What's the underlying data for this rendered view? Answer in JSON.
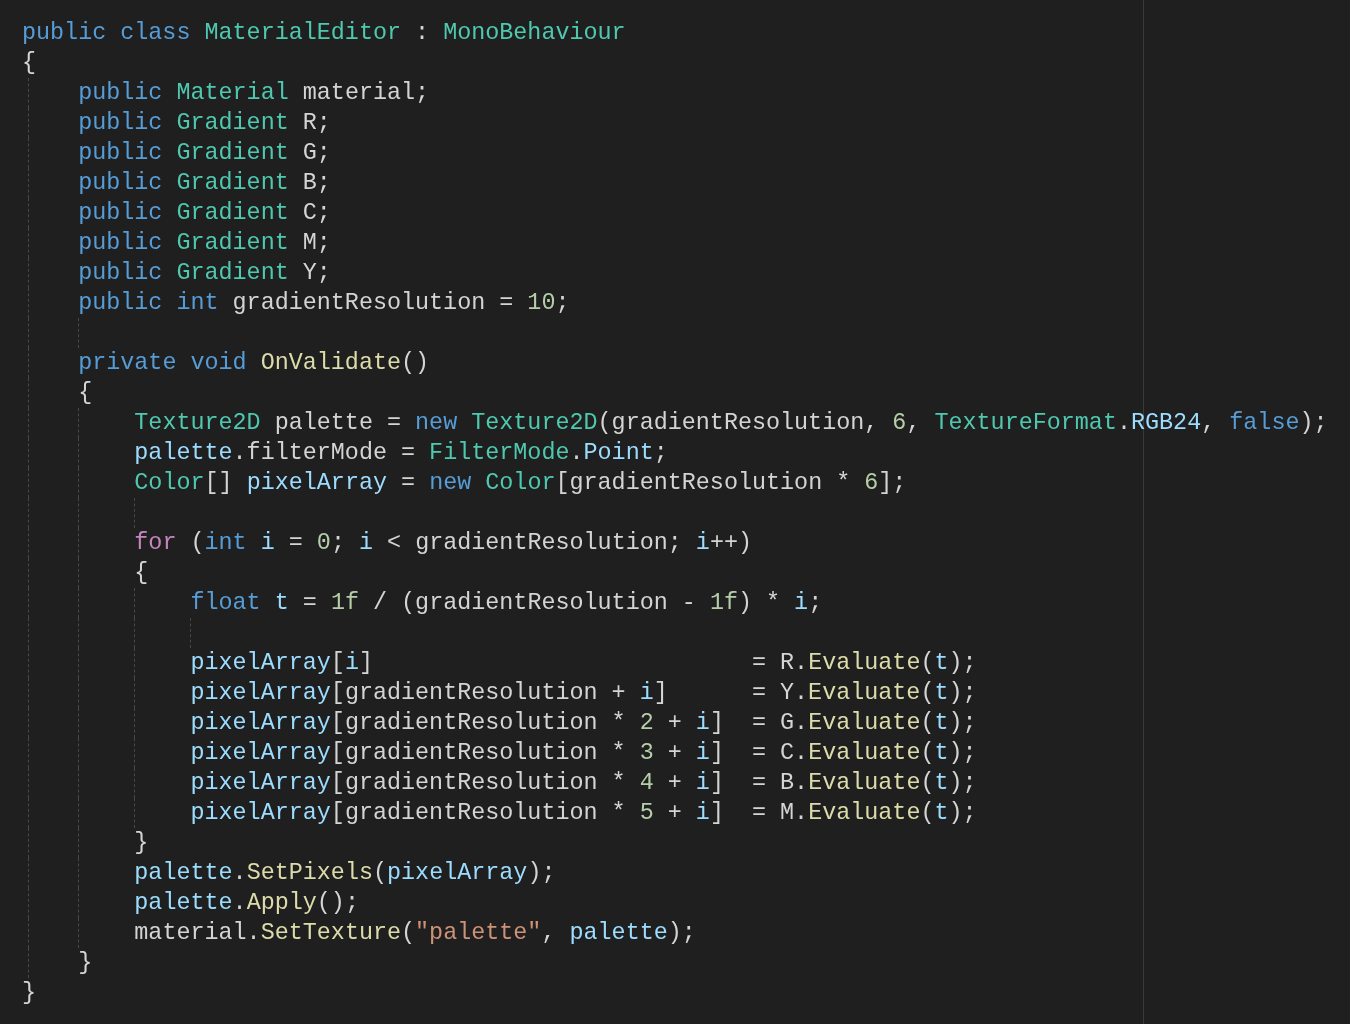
{
  "editor": {
    "lines": [
      {
        "kind": "code",
        "tokens": [
          {
            "kind": "keyword",
            "text": "public class "
          },
          {
            "kind": "type",
            "text": "MaterialEditor"
          },
          {
            "kind": "plain",
            "text": " : "
          },
          {
            "kind": "type",
            "text": "MonoBehaviour"
          }
        ]
      },
      {
        "kind": "code",
        "tokens": [
          {
            "kind": "plain",
            "text": "{"
          }
        ]
      },
      {
        "kind": "code",
        "tokens": [
          {
            "kind": "keyword",
            "text": "    public "
          },
          {
            "kind": "type",
            "text": "Material "
          },
          {
            "kind": "plain",
            "text": "material;"
          }
        ]
      },
      {
        "kind": "code",
        "tokens": [
          {
            "kind": "keyword",
            "text": "    public "
          },
          {
            "kind": "type",
            "text": "Gradient "
          },
          {
            "kind": "plain",
            "text": "R;"
          }
        ]
      },
      {
        "kind": "code",
        "tokens": [
          {
            "kind": "keyword",
            "text": "    public "
          },
          {
            "kind": "type",
            "text": "Gradient "
          },
          {
            "kind": "plain",
            "text": "G;"
          }
        ]
      },
      {
        "kind": "code",
        "tokens": [
          {
            "kind": "keyword",
            "text": "    public "
          },
          {
            "kind": "type",
            "text": "Gradient "
          },
          {
            "kind": "plain",
            "text": "B;"
          }
        ]
      },
      {
        "kind": "code",
        "tokens": [
          {
            "kind": "keyword",
            "text": "    public "
          },
          {
            "kind": "type",
            "text": "Gradient "
          },
          {
            "kind": "plain",
            "text": "C;"
          }
        ]
      },
      {
        "kind": "code",
        "tokens": [
          {
            "kind": "keyword",
            "text": "    public "
          },
          {
            "kind": "type",
            "text": "Gradient "
          },
          {
            "kind": "plain",
            "text": "M;"
          }
        ]
      },
      {
        "kind": "code",
        "tokens": [
          {
            "kind": "keyword",
            "text": "    public "
          },
          {
            "kind": "type",
            "text": "Gradient "
          },
          {
            "kind": "plain",
            "text": "Y;"
          }
        ]
      },
      {
        "kind": "code",
        "tokens": [
          {
            "kind": "keyword",
            "text": "    public int "
          },
          {
            "kind": "plain",
            "text": "gradientResolution = "
          },
          {
            "kind": "number",
            "text": "10"
          },
          {
            "kind": "plain",
            "text": ";"
          }
        ]
      },
      {
        "kind": "blank"
      },
      {
        "kind": "code",
        "tokens": [
          {
            "kind": "keyword",
            "text": "    private void "
          },
          {
            "kind": "function",
            "text": "OnValidate"
          },
          {
            "kind": "plain",
            "text": "()"
          }
        ]
      },
      {
        "kind": "code",
        "tokens": [
          {
            "kind": "plain",
            "text": "    {"
          }
        ]
      },
      {
        "kind": "code",
        "tokens": [
          {
            "kind": "type",
            "text": "        Texture2D "
          },
          {
            "kind": "plain",
            "text": "palette = "
          },
          {
            "kind": "keyword",
            "text": "new "
          },
          {
            "kind": "type",
            "text": "Texture2D"
          },
          {
            "kind": "plain",
            "text": "(gradientResolution, "
          },
          {
            "kind": "number",
            "text": "6"
          },
          {
            "kind": "plain",
            "text": ", "
          },
          {
            "kind": "type",
            "text": "TextureFormat"
          },
          {
            "kind": "plain",
            "text": "."
          },
          {
            "kind": "variable",
            "text": "RGB24"
          },
          {
            "kind": "plain",
            "text": ", "
          },
          {
            "kind": "keyword",
            "text": "false"
          },
          {
            "kind": "plain",
            "text": ");"
          }
        ]
      },
      {
        "kind": "code",
        "tokens": [
          {
            "kind": "variable",
            "text": "        palette"
          },
          {
            "kind": "plain",
            "text": ".filterMode = "
          },
          {
            "kind": "type",
            "text": "FilterMode"
          },
          {
            "kind": "plain",
            "text": "."
          },
          {
            "kind": "variable",
            "text": "Point"
          },
          {
            "kind": "plain",
            "text": ";"
          }
        ]
      },
      {
        "kind": "code",
        "tokens": [
          {
            "kind": "type",
            "text": "        Color"
          },
          {
            "kind": "plain",
            "text": "[] "
          },
          {
            "kind": "variable",
            "text": "pixelArray"
          },
          {
            "kind": "plain",
            "text": " = "
          },
          {
            "kind": "keyword",
            "text": "new "
          },
          {
            "kind": "type",
            "text": "Color"
          },
          {
            "kind": "plain",
            "text": "[gradientResolution * "
          },
          {
            "kind": "number",
            "text": "6"
          },
          {
            "kind": "plain",
            "text": "];"
          }
        ]
      },
      {
        "kind": "blank"
      },
      {
        "kind": "code",
        "tokens": [
          {
            "kind": "control",
            "text": "        for"
          },
          {
            "kind": "plain",
            "text": " ("
          },
          {
            "kind": "keyword",
            "text": "int "
          },
          {
            "kind": "variable",
            "text": "i"
          },
          {
            "kind": "plain",
            "text": " = "
          },
          {
            "kind": "number",
            "text": "0"
          },
          {
            "kind": "plain",
            "text": "; "
          },
          {
            "kind": "variable",
            "text": "i"
          },
          {
            "kind": "plain",
            "text": " < gradientResolution; "
          },
          {
            "kind": "variable",
            "text": "i"
          },
          {
            "kind": "plain",
            "text": "++)"
          }
        ]
      },
      {
        "kind": "code",
        "tokens": [
          {
            "kind": "plain",
            "text": "        {"
          }
        ]
      },
      {
        "kind": "code",
        "tokens": [
          {
            "kind": "keyword",
            "text": "            float "
          },
          {
            "kind": "variable",
            "text": "t"
          },
          {
            "kind": "plain",
            "text": " = "
          },
          {
            "kind": "number",
            "text": "1f"
          },
          {
            "kind": "plain",
            "text": " / (gradientResolution - "
          },
          {
            "kind": "number",
            "text": "1f"
          },
          {
            "kind": "plain",
            "text": ") * "
          },
          {
            "kind": "variable",
            "text": "i"
          },
          {
            "kind": "plain",
            "text": ";"
          }
        ]
      },
      {
        "kind": "blank"
      },
      {
        "kind": "code",
        "tokens": [
          {
            "kind": "variable",
            "text": "            pixelArray"
          },
          {
            "kind": "plain",
            "text": "["
          },
          {
            "kind": "variable",
            "text": "i"
          },
          {
            "kind": "plain",
            "text": "]                           = R."
          },
          {
            "kind": "function",
            "text": "Evaluate"
          },
          {
            "kind": "plain",
            "text": "("
          },
          {
            "kind": "variable",
            "text": "t"
          },
          {
            "kind": "plain",
            "text": ");"
          }
        ]
      },
      {
        "kind": "code",
        "tokens": [
          {
            "kind": "variable",
            "text": "            pixelArray"
          },
          {
            "kind": "plain",
            "text": "[gradientResolution + "
          },
          {
            "kind": "variable",
            "text": "i"
          },
          {
            "kind": "plain",
            "text": "]      = Y."
          },
          {
            "kind": "function",
            "text": "Evaluate"
          },
          {
            "kind": "plain",
            "text": "("
          },
          {
            "kind": "variable",
            "text": "t"
          },
          {
            "kind": "plain",
            "text": ");"
          }
        ]
      },
      {
        "kind": "code",
        "tokens": [
          {
            "kind": "variable",
            "text": "            pixelArray"
          },
          {
            "kind": "plain",
            "text": "[gradientResolution * "
          },
          {
            "kind": "number",
            "text": "2"
          },
          {
            "kind": "plain",
            "text": " + "
          },
          {
            "kind": "variable",
            "text": "i"
          },
          {
            "kind": "plain",
            "text": "]  = G."
          },
          {
            "kind": "function",
            "text": "Evaluate"
          },
          {
            "kind": "plain",
            "text": "("
          },
          {
            "kind": "variable",
            "text": "t"
          },
          {
            "kind": "plain",
            "text": ");"
          }
        ]
      },
      {
        "kind": "code",
        "tokens": [
          {
            "kind": "variable",
            "text": "            pixelArray"
          },
          {
            "kind": "plain",
            "text": "[gradientResolution * "
          },
          {
            "kind": "number",
            "text": "3"
          },
          {
            "kind": "plain",
            "text": " + "
          },
          {
            "kind": "variable",
            "text": "i"
          },
          {
            "kind": "plain",
            "text": "]  = C."
          },
          {
            "kind": "function",
            "text": "Evaluate"
          },
          {
            "kind": "plain",
            "text": "("
          },
          {
            "kind": "variable",
            "text": "t"
          },
          {
            "kind": "plain",
            "text": ");"
          }
        ]
      },
      {
        "kind": "code",
        "tokens": [
          {
            "kind": "variable",
            "text": "            pixelArray"
          },
          {
            "kind": "plain",
            "text": "[gradientResolution * "
          },
          {
            "kind": "number",
            "text": "4"
          },
          {
            "kind": "plain",
            "text": " + "
          },
          {
            "kind": "variable",
            "text": "i"
          },
          {
            "kind": "plain",
            "text": "]  = B."
          },
          {
            "kind": "function",
            "text": "Evaluate"
          },
          {
            "kind": "plain",
            "text": "("
          },
          {
            "kind": "variable",
            "text": "t"
          },
          {
            "kind": "plain",
            "text": ");"
          }
        ]
      },
      {
        "kind": "code",
        "tokens": [
          {
            "kind": "variable",
            "text": "            pixelArray"
          },
          {
            "kind": "plain",
            "text": "[gradientResolution * "
          },
          {
            "kind": "number",
            "text": "5"
          },
          {
            "kind": "plain",
            "text": " + "
          },
          {
            "kind": "variable",
            "text": "i"
          },
          {
            "kind": "plain",
            "text": "]  = M."
          },
          {
            "kind": "function",
            "text": "Evaluate"
          },
          {
            "kind": "plain",
            "text": "("
          },
          {
            "kind": "variable",
            "text": "t"
          },
          {
            "kind": "plain",
            "text": ");"
          }
        ]
      },
      {
        "kind": "code",
        "tokens": [
          {
            "kind": "plain",
            "text": "        }"
          }
        ]
      },
      {
        "kind": "code",
        "tokens": [
          {
            "kind": "variable",
            "text": "        palette"
          },
          {
            "kind": "plain",
            "text": "."
          },
          {
            "kind": "function",
            "text": "SetPixels"
          },
          {
            "kind": "plain",
            "text": "("
          },
          {
            "kind": "variable",
            "text": "pixelArray"
          },
          {
            "kind": "plain",
            "text": ");"
          }
        ]
      },
      {
        "kind": "code",
        "tokens": [
          {
            "kind": "variable",
            "text": "        palette"
          },
          {
            "kind": "plain",
            "text": "."
          },
          {
            "kind": "function",
            "text": "Apply"
          },
          {
            "kind": "plain",
            "text": "();"
          }
        ]
      },
      {
        "kind": "code",
        "tokens": [
          {
            "kind": "plain",
            "text": "        material."
          },
          {
            "kind": "function",
            "text": "SetTexture"
          },
          {
            "kind": "plain",
            "text": "("
          },
          {
            "kind": "string",
            "text": "\"palette\""
          },
          {
            "kind": "plain",
            "text": ", "
          },
          {
            "kind": "variable",
            "text": "palette"
          },
          {
            "kind": "plain",
            "text": ");"
          }
        ]
      },
      {
        "kind": "code",
        "tokens": [
          {
            "kind": "plain",
            "text": "    }"
          }
        ]
      },
      {
        "kind": "code",
        "tokens": [
          {
            "kind": "plain",
            "text": "}"
          }
        ]
      }
    ]
  }
}
